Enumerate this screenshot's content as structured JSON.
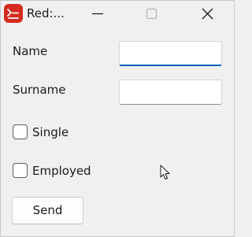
{
  "window": {
    "title": "Red:...",
    "icon": "red-app-icon",
    "controls": {
      "minimize_icon": "minimize-icon",
      "maximize_icon": "maximize-icon",
      "close_icon": "close-icon"
    }
  },
  "form": {
    "name_label": "Name",
    "name_value": "",
    "surname_label": "Surname",
    "surname_value": "",
    "single_label": "Single",
    "single_checked": false,
    "employed_label": "Employed",
    "employed_checked": false,
    "send_label": "Send"
  },
  "colors": {
    "app_icon": "#d52a1f",
    "focus_underline": "#005fb8",
    "background": "#f0f0f0"
  }
}
